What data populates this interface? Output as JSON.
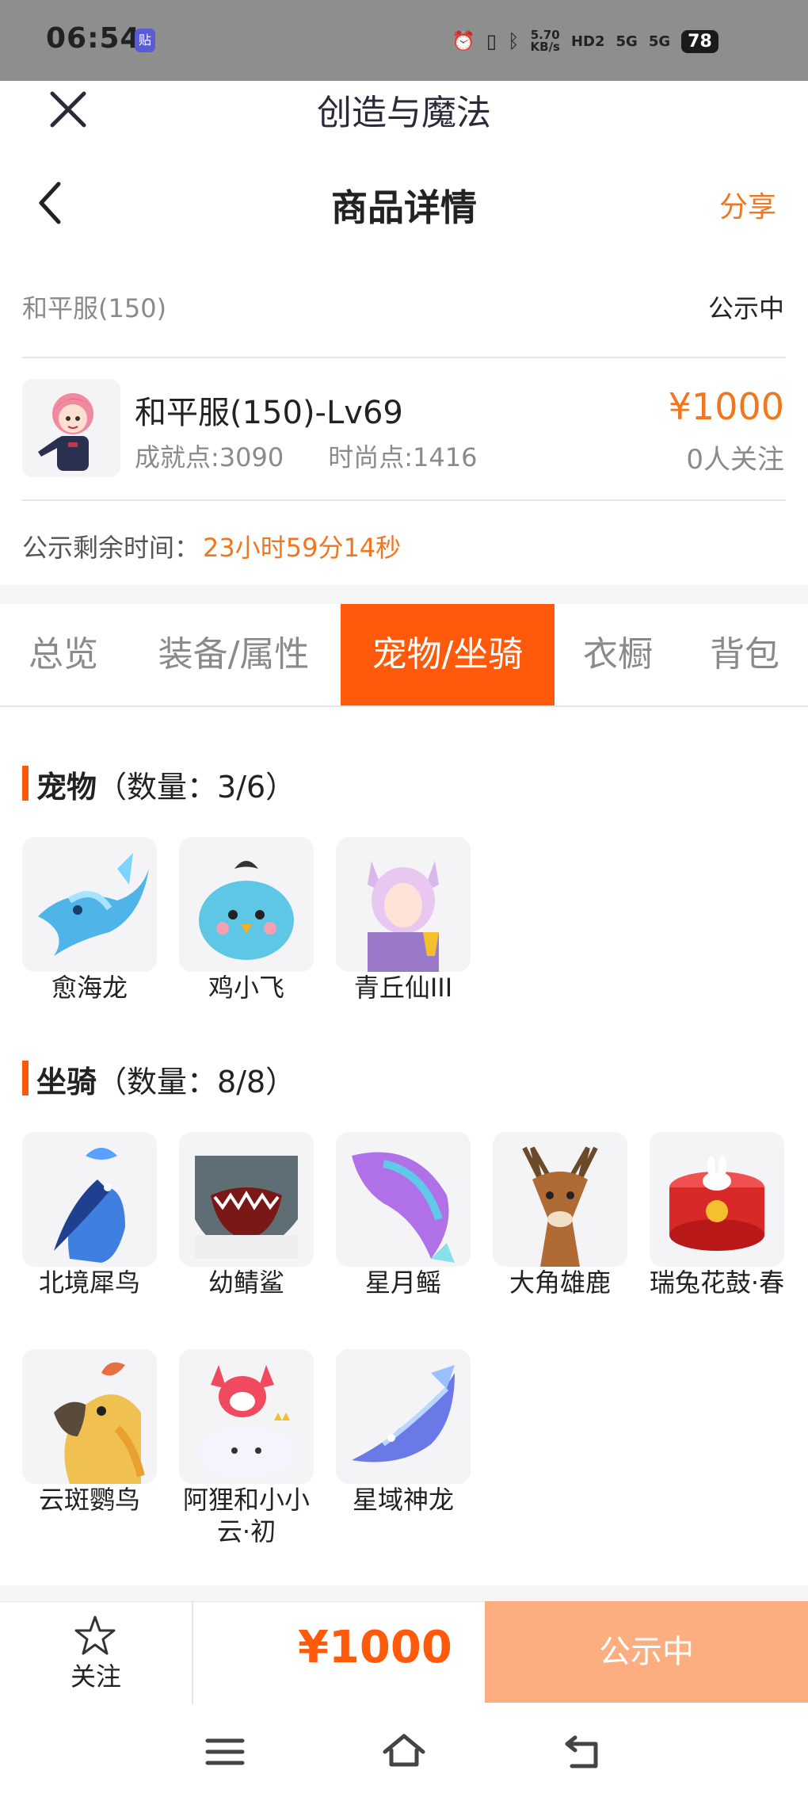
{
  "status_bar": {
    "time": "06:54",
    "app_badge": "贴",
    "net_speed_top": "5.70",
    "net_speed_bottom": "KB/s",
    "hd_label": "HD2",
    "signal1": "5G",
    "signal2": "5G",
    "battery": "78"
  },
  "header": {
    "app_title": "创造与魔法",
    "page_title": "商品详情",
    "share_label": "分享"
  },
  "listing": {
    "server": "和平服(150)",
    "status": "公示中",
    "name": "和平服(150)-Lv69",
    "achievement": "成就点:3090",
    "fashion": "时尚点:1416",
    "price": "¥1000",
    "followers": "0人关注",
    "remain_label": "公示剩余时间：",
    "remain_value": "23小时59分14秒"
  },
  "tabs": [
    {
      "label": "总览"
    },
    {
      "label": "装备/属性"
    },
    {
      "label": "宠物/坐骑",
      "active": true
    },
    {
      "label": "衣橱"
    },
    {
      "label": "背包"
    }
  ],
  "pets": {
    "title": "宠物",
    "count": "（数量：3/6）",
    "items": [
      {
        "name": "愈海龙",
        "icon": "sea-dragon-icon"
      },
      {
        "name": "鸡小飞",
        "icon": "blue-chick-icon"
      },
      {
        "name": "青丘仙III",
        "icon": "fox-fairy-icon"
      }
    ]
  },
  "mounts": {
    "title": "坐骑",
    "count": "（数量：8/8）",
    "items": [
      {
        "name": "北境犀鸟",
        "icon": "hornbill-icon"
      },
      {
        "name": "幼鲭鲨",
        "icon": "shark-icon"
      },
      {
        "name": "星月鳐",
        "icon": "ray-icon"
      },
      {
        "name": "大角雄鹿",
        "icon": "stag-icon"
      },
      {
        "name": "瑞兔花鼓·春",
        "icon": "rabbit-drum-icon"
      },
      {
        "name": "云斑鹦鸟",
        "icon": "parrot-icon"
      },
      {
        "name": "阿狸和小小云·初",
        "icon": "ali-cloud-icon"
      },
      {
        "name": "星域神龙",
        "icon": "star-dragon-icon"
      }
    ]
  },
  "bottom_bar": {
    "follow_label": "关注",
    "price": "¥1000",
    "action_label": "公示中"
  },
  "colors": {
    "accent": "#ff5a0c",
    "price": "#f0761f",
    "action_button": "#fcae80"
  }
}
